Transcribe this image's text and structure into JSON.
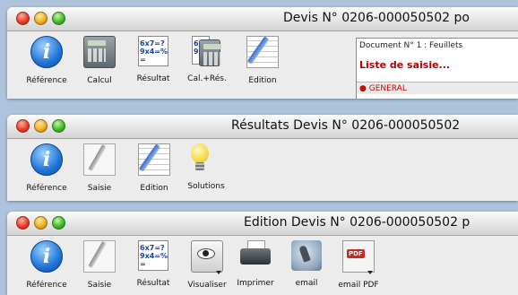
{
  "windows": [
    {
      "title": "Devis N° 0206-000050502  po",
      "tools": [
        {
          "label": "Référence",
          "icon": "info-icon"
        },
        {
          "label": "Calcul",
          "icon": "calculator-icon"
        },
        {
          "label": "Résultat",
          "icon": "result-sheet-icon"
        },
        {
          "label": "Cal.+Rés.",
          "icon": "calc-result-icon"
        },
        {
          "label": "Edition",
          "icon": "edit-document-icon"
        }
      ],
      "doc_panel": {
        "header": "Document N° 1 : Feuillets",
        "selected": "Liste de saisie...",
        "group": "● GENERAL",
        "clipped": "..."
      }
    },
    {
      "title": "Résultats Devis N° 0206-000050502",
      "tools": [
        {
          "label": "Référence",
          "icon": "info-icon"
        },
        {
          "label": "Saisie",
          "icon": "pencil-page-icon"
        },
        {
          "label": "Edition",
          "icon": "edit-document-icon"
        },
        {
          "label": "Solutions",
          "icon": "lightbulb-icon"
        }
      ]
    },
    {
      "title": "Edition Devis N° 0206-000050502  p",
      "tools": [
        {
          "label": "Référence",
          "icon": "info-icon"
        },
        {
          "label": "Saisie",
          "icon": "pencil-page-icon"
        },
        {
          "label": "Résultat",
          "icon": "result-sheet-icon"
        },
        {
          "label": "Visualiser",
          "icon": "eye-icon"
        },
        {
          "label": "Imprimer",
          "icon": "printer-icon"
        },
        {
          "label": "email",
          "icon": "email-stamp-icon"
        },
        {
          "label": "email PDF",
          "icon": "pdf-icon"
        }
      ]
    }
  ],
  "sheet_icon_text": [
    "6x7=?",
    "9x4=%",
    "="
  ]
}
